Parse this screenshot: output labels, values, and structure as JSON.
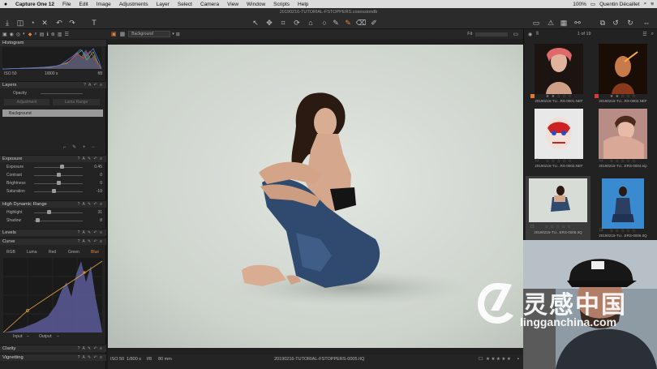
{
  "menubar": {
    "app": "Capture One 12",
    "items": [
      "File",
      "Edit",
      "Image",
      "Adjustments",
      "Layer",
      "Select",
      "Camera",
      "View",
      "Window",
      "Scripts",
      "Help"
    ],
    "battery": "100%",
    "user": "Quentin Décaillet"
  },
  "window": {
    "title": "20190216-TUTORIAL-FSTOPPERS.cosessiondb"
  },
  "histogram": {
    "title": "Histogram",
    "iso": "ISO 50",
    "shutter": "1/800 s",
    "aperture": "f/8"
  },
  "layers": {
    "title": "Layers",
    "opacity_label": "Opacity",
    "adjustment_button": "Adjustment",
    "luma_range_button": "Luma Range",
    "layer_name": "Background"
  },
  "exposure": {
    "title": "Exposure",
    "sliders": [
      {
        "label": "Exposure",
        "value": "0.45",
        "pos": 0.58
      },
      {
        "label": "Contrast",
        "value": "0",
        "pos": 0.5
      },
      {
        "label": "Brightness",
        "value": "0",
        "pos": 0.5
      },
      {
        "label": "Saturation",
        "value": "-19",
        "pos": 0.41
      }
    ]
  },
  "hdr": {
    "title": "High Dynamic Range",
    "sliders": [
      {
        "label": "Highlight",
        "value": "31",
        "pos": 0.31
      },
      {
        "label": "Shadow",
        "value": "8",
        "pos": 0.08
      }
    ]
  },
  "levels": {
    "title": "Levels"
  },
  "curve": {
    "title": "Curve",
    "tabs": [
      "RGB",
      "Luma",
      "Red",
      "Green",
      "Blue"
    ],
    "active_tab": "Blue",
    "input_label": "Input:",
    "input_value": "–",
    "output_label": "Output:",
    "output_value": "–"
  },
  "clarity": {
    "title": "Clarity"
  },
  "vignetting": {
    "title": "Vignetting"
  },
  "viewer": {
    "variant": "Background",
    "fit": "Fit",
    "status_iso": "ISO 50",
    "status_shutter": "1/800 s",
    "status_aperture": "f/8",
    "status_focal": "80 mm",
    "status_file": "20190216-TUTORIAL-FSTOPPERS-0005.IIQ",
    "rating_stars": "★ ★ ★ ★ ★"
  },
  "browser": {
    "counter": "1 of 19",
    "thumbnails": [
      {
        "name": "20190216-TU...RS-0001.NEF",
        "stars": "★ ★ ☆ ☆ ☆",
        "tag": "#e07a28"
      },
      {
        "name": "20190216-TU...RS-0002.NEF",
        "stars": "★ ★ ☆ ☆ ☆",
        "tag": "#d63a3a"
      },
      {
        "name": "20190216-TU...RS-0003.NEF",
        "stars": "☆ ☆ ☆ ☆ ☆",
        "tag": ""
      },
      {
        "name": "20190216-TU...ERS-0004.eip",
        "stars": "☆ ☆ ☆ ☆ ☆",
        "tag": ""
      },
      {
        "name": "20190216-TU...ERS-0005.IIQ",
        "stars": "☆ ☆ ☆ ☆ ☆",
        "tag": ""
      },
      {
        "name": "20190216-TU...ERS-0006.IIQ",
        "stars": "☆ ☆ ☆ ☆ ☆",
        "tag": ""
      }
    ]
  },
  "watermark": {
    "chinese": "灵感中国",
    "latin": "lingganchina.com"
  },
  "colors": {
    "accent": "#e8823a",
    "panel": "#232323",
    "backdrop": "#d9dfd9"
  }
}
